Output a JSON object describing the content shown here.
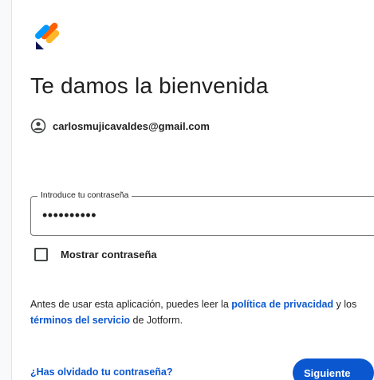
{
  "colors": {
    "accent": "#0b57d0",
    "text": "#1f1f1f",
    "logo_blue": "#0a1551",
    "logo_orange": "#ff6100",
    "logo_yellow": "#ffb629",
    "logo_lightblue": "#0099ff"
  },
  "logo": {
    "icon": "jotform-logo"
  },
  "header": {
    "title": "Te damos la bienvenida"
  },
  "account": {
    "icon": "account-circle-icon",
    "email": "carlosmujicavaldes@gmail.com"
  },
  "password": {
    "label": "Introduce tu contraseña",
    "value": "••••••••••"
  },
  "show_password": {
    "label": "Mostrar contraseña",
    "checked": false
  },
  "terms": {
    "text_before": "Antes de usar esta aplicación, puedes leer la ",
    "privacy_link": "política de privacidad",
    "text_middle_1": " y los ",
    "terms_link": "términos del servicio",
    "text_after": " de Jotform."
  },
  "actions": {
    "forgot_label": "¿Has olvidado tu contraseña?",
    "next_label": "Siguiente"
  }
}
